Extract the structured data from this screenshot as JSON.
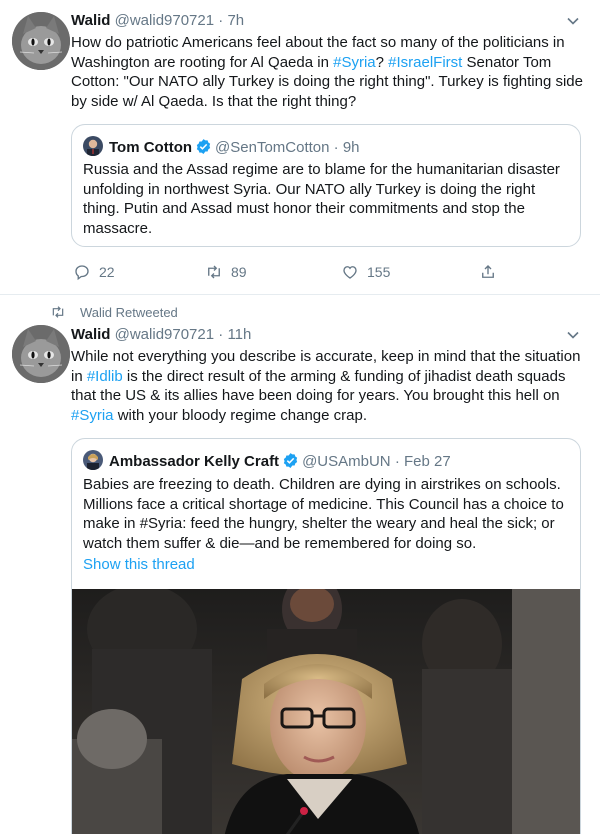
{
  "tweet1": {
    "name": "Walid",
    "handle": "@walid970721",
    "separator": "·",
    "time": "7h",
    "text_parts": [
      "How do patriotic Americans feel about the fact so many of the politicians in Washington are rooting for Al Qaeda in ",
      "#Syria",
      "? ",
      "#IsraelFirst",
      " Senator Tom Cotton: \"Our NATO ally Turkey is doing the right thing\". Turkey is fighting side by side w/ Al Qaeda. Is that the right thing?"
    ],
    "quote": {
      "name": "Tom Cotton",
      "handle": "@SenTomCotton",
      "separator": "·",
      "time": "9h",
      "text": "Russia and the Assad regime are to blame for the humanitarian disaster unfolding in northwest Syria. Our NATO ally Turkey is doing the right thing. Putin and Assad must honor their commitments and stop the massacre."
    },
    "actions": {
      "replies": "22",
      "retweets": "89",
      "likes": "155"
    }
  },
  "retweet_banner": {
    "label": "Walid Retweeted"
  },
  "tweet2": {
    "name": "Walid",
    "handle": "@walid970721",
    "separator": "·",
    "time": "11h",
    "text_parts": [
      "While not everything you describe is accurate, keep in mind that the situation in ",
      "#Idlib",
      " is the direct result of the arming & funding of jihadist death squads that the US & its allies have been doing for years. You brought this hell on ",
      "#Syria",
      " with your bloody regime change crap."
    ],
    "quote": {
      "name": "Ambassador Kelly Craft",
      "handle": "@USAmbUN",
      "separator": "·",
      "time": "Feb 27",
      "text": "Babies are freezing to death. Children are dying in airstrikes on schools. Millions face a critical shortage of medicine. This Council has a choice to make in #Syria: feed the hungry, shelter the weary and heal the sick; or watch them suffer & die—and be remembered for doing so.",
      "show_thread": "Show this thread"
    }
  },
  "colors": {
    "link": "#1da1f2",
    "muted": "#657786",
    "verified": "#1da1f2",
    "divider": "#e6ecf0"
  },
  "icons": [
    "chevron-down-icon",
    "verified-badge-icon",
    "reply-icon",
    "retweet-icon",
    "like-icon",
    "share-icon"
  ]
}
